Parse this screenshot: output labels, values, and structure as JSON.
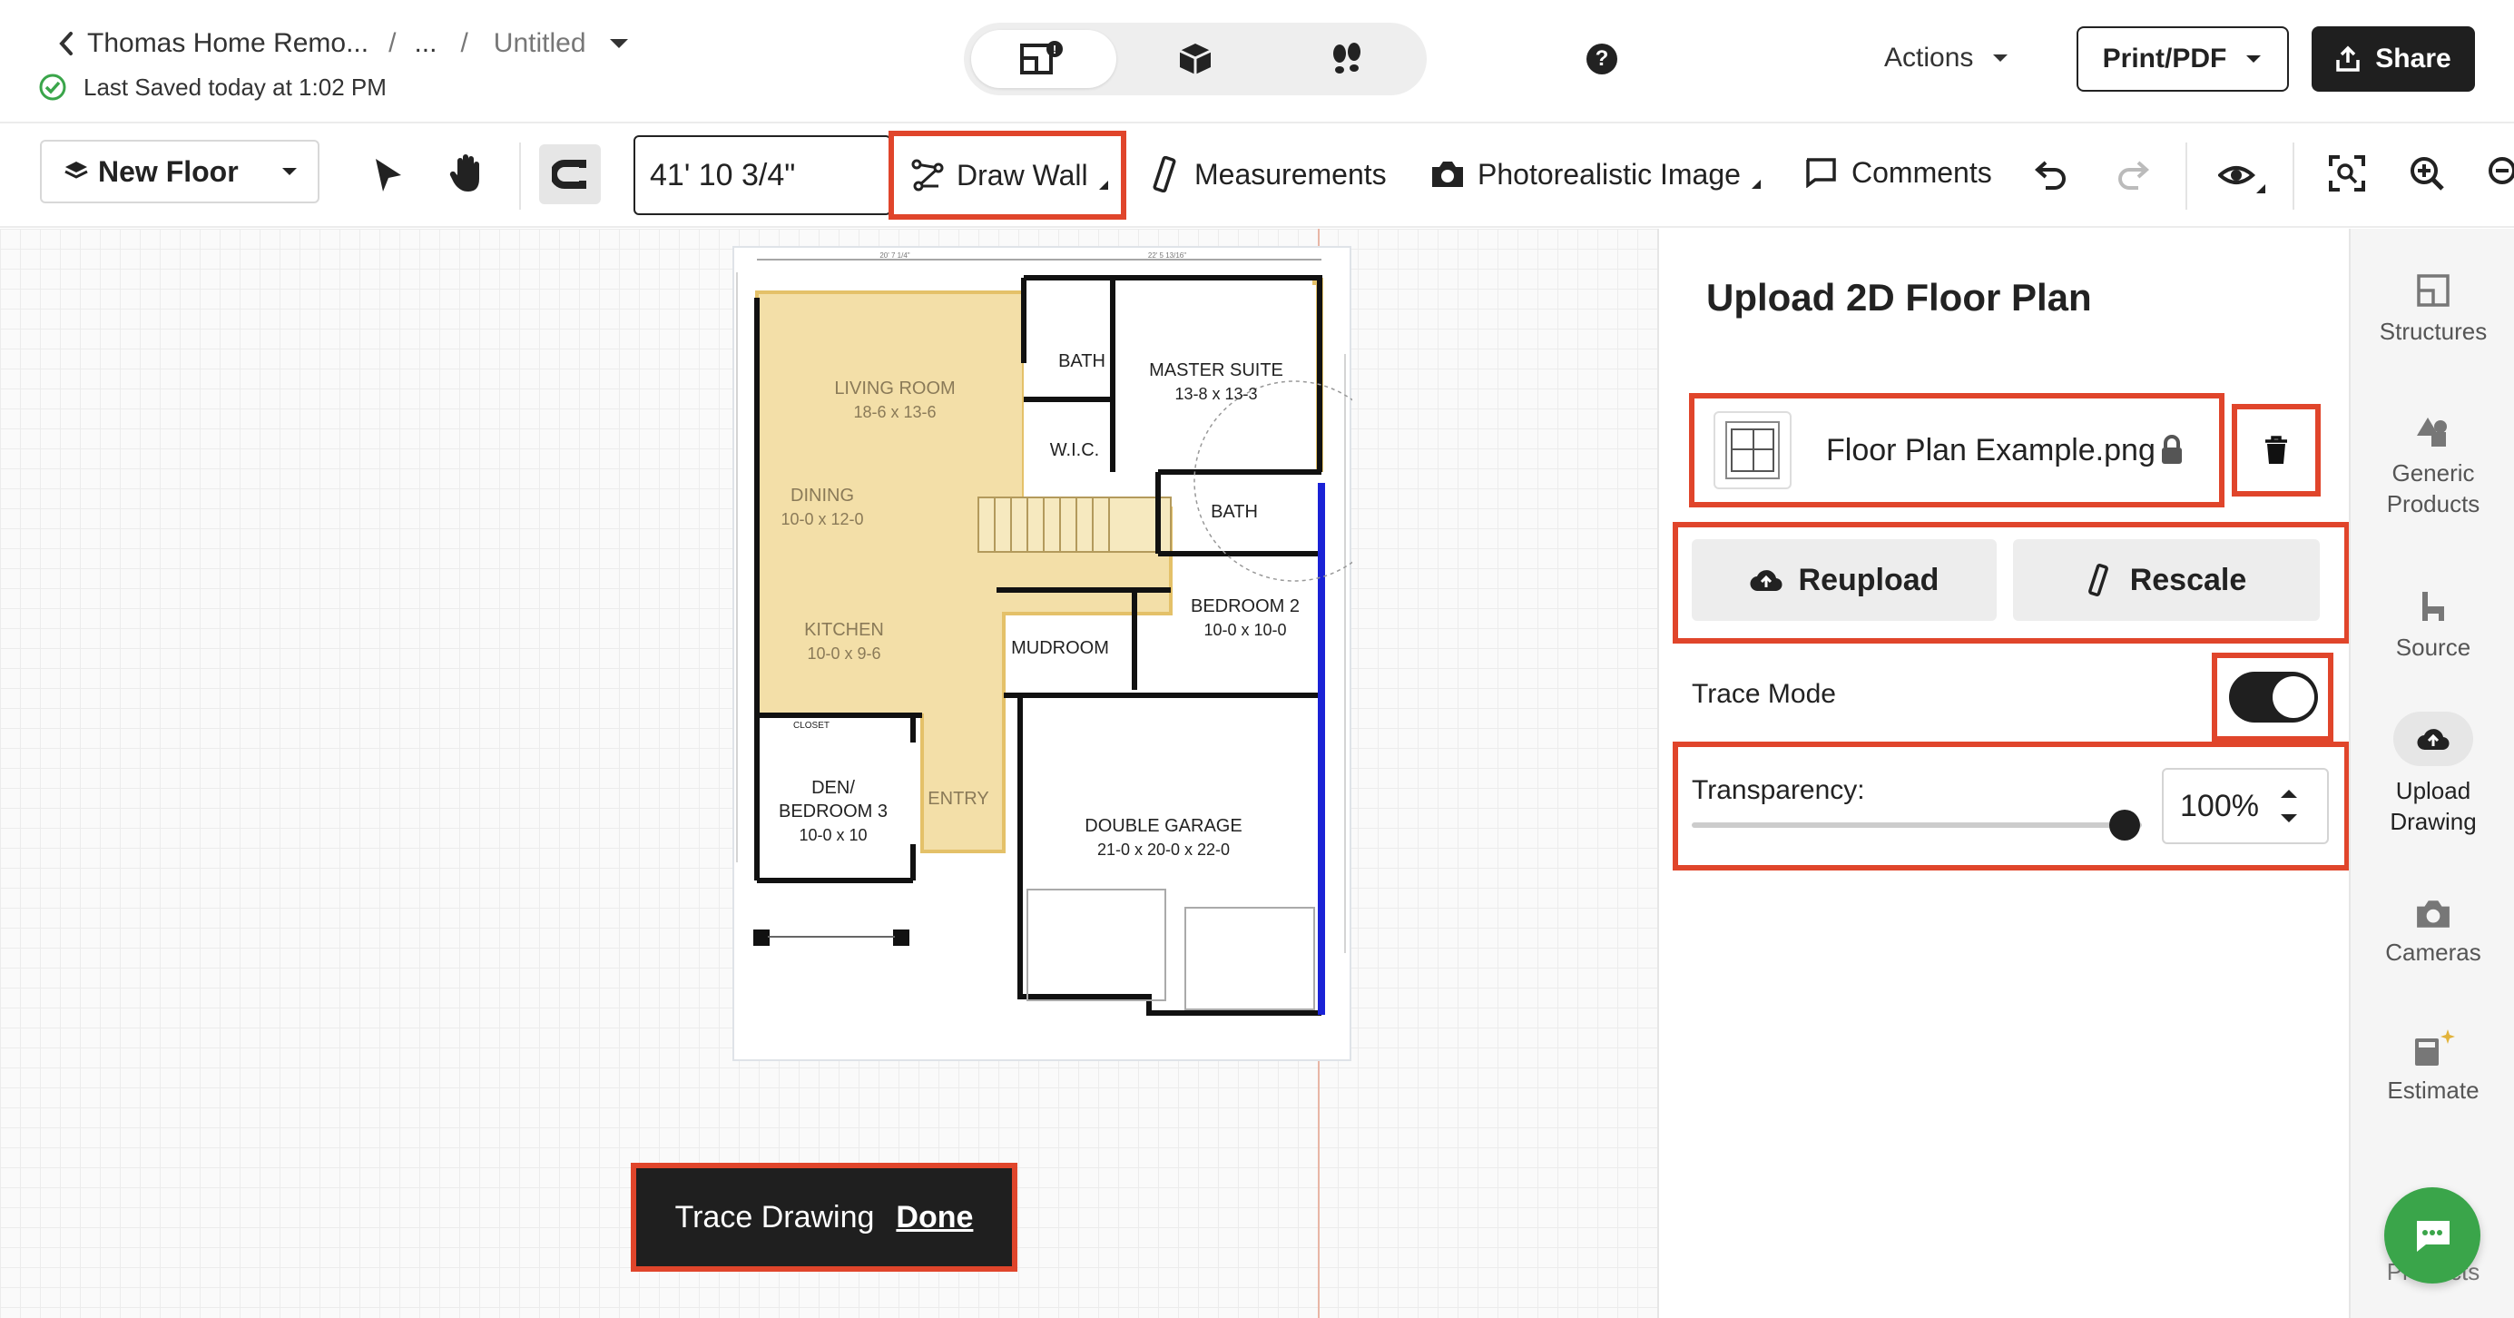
{
  "header": {
    "back_label": "Thomas Home Remo...",
    "sep1": "/",
    "ellipsis": "...",
    "sep2": "/",
    "doc_title": "Untitled",
    "saved_status": "Last Saved today at 1:02 PM",
    "actions_label": "Actions",
    "print_label": "Print/PDF",
    "share_label": "Share",
    "help_glyph": "?"
  },
  "view_modes": [
    "2d-floor-plan-icon",
    "3d-box-icon",
    "walkthrough-footsteps-icon"
  ],
  "toolbar": {
    "floor_select": "New Floor",
    "length_value": "41' 10 3/4\"",
    "draw_wall": "Draw Wall",
    "measurements": "Measurements",
    "photorealistic": "Photorealistic Image",
    "comments": "Comments"
  },
  "floor_plan": {
    "dim_top_left": "20' 7 1/4\"",
    "dim_top_right": "22' 5 13/16\"",
    "rooms": {
      "living": "LIVING ROOM",
      "living_size": "18-6 x 13-6",
      "dining": "DINING",
      "dining_size": "10-0 x 12-0",
      "kitchen": "KITCHEN",
      "kitchen_size": "10-0 x 9-6",
      "bath1": "BATH",
      "wic": "W.I.C.",
      "master": "MASTER SUITE",
      "master_size": "13-8 x 13-3",
      "bath2": "BATH",
      "bedroom2": "BEDROOM 2",
      "bedroom2_size": "10-0 x 10-0",
      "mudroom": "MUDROOM",
      "den": "DEN/",
      "bedroom3": "BEDROOM 3",
      "den_size": "10-0 x 10",
      "entry": "ENTRY",
      "garage": "DOUBLE GARAGE",
      "garage_size": "21-0 x 20-0 x 22-0",
      "closet": "CLOSET"
    }
  },
  "trace_bar": {
    "label": "Trace Drawing",
    "done": "Done"
  },
  "panel": {
    "title": "Upload 2D Floor Plan",
    "file_name": "Floor Plan Example.png",
    "reupload": "Reupload",
    "rescale": "Rescale",
    "trace_mode_label": "Trace Mode",
    "trace_mode_on": true,
    "transparency_label": "Transparency:",
    "transparency_value": "100%",
    "transparency_fraction": 1.0
  },
  "rightbar": {
    "structures": "Structures",
    "generic_products_1": "Generic",
    "generic_products_2": "Products",
    "source": "Source",
    "upload_1": "Upload",
    "upload_2": "Drawing",
    "cameras": "Cameras",
    "estimate": "Estimate",
    "products_partial": "Products"
  },
  "colors": {
    "highlight": "#e0452b",
    "dark": "#1f1f1f",
    "traced_fill": "#f3dfa8",
    "wall_blue": "#1a22d6",
    "chat_green": "#3aa54a"
  }
}
